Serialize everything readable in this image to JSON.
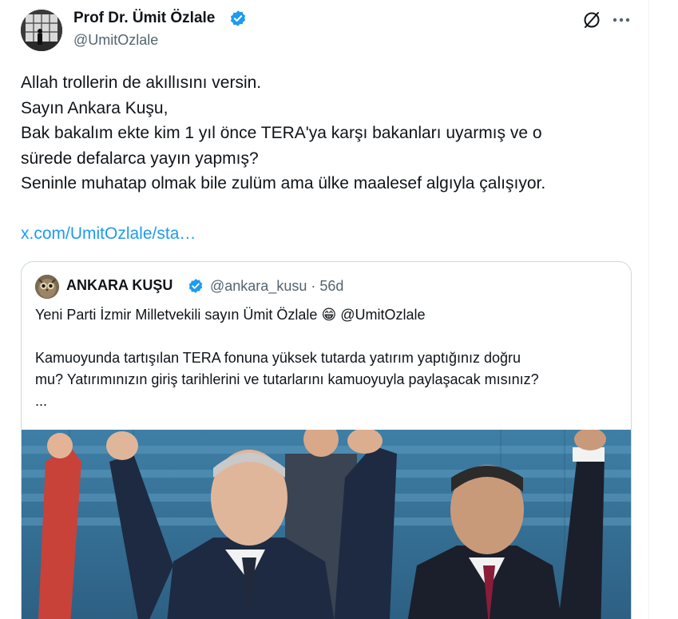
{
  "author": {
    "name": "Prof Dr. Ümit Özlale",
    "handle": "@UmitOzlale",
    "verified": true
  },
  "actions": {
    "grok_icon": "grok-icon",
    "more_icon": "more-icon"
  },
  "tweet": {
    "lines": [
      "Allah trollerin de akıllısını versin.",
      "Sayın Ankara Kuşu,",
      "Bak bakalım ekte kim 1 yıl önce TERA'ya karşı bakanları uyarmış ve o",
      "sürede defalarca yayın yapmış?",
      "Seninle muhatap olmak bile zulüm ama ülke maalesef algıyla çalışıyor."
    ],
    "link": "x.com/UmitOzlale/sta…"
  },
  "quote": {
    "name": "ANKARA KUŞU",
    "verified": true,
    "handle_time": "@ankara_kusu · 56d",
    "line1_text": "Yeni Parti İzmir Milletvekili sayın Ümit Özlale ",
    "line1_emoji": "😁",
    "line1_mention": " @UmitOzlale",
    "para2": [
      "Kamuoyunda tartışılan TERA fonuna yüksek tutarda yatırım yaptığınız doğru",
      "mu? Yatırımınızın giriş tarihlerini ve tutarlarını kamuoyuyla paylaşacak mısınız?",
      "..."
    ]
  },
  "colors": {
    "text": "#0f1419",
    "secondary": "#536471",
    "link": "#1d9bf0",
    "verified": "#1d9bf0",
    "border": "#cfd9de"
  }
}
